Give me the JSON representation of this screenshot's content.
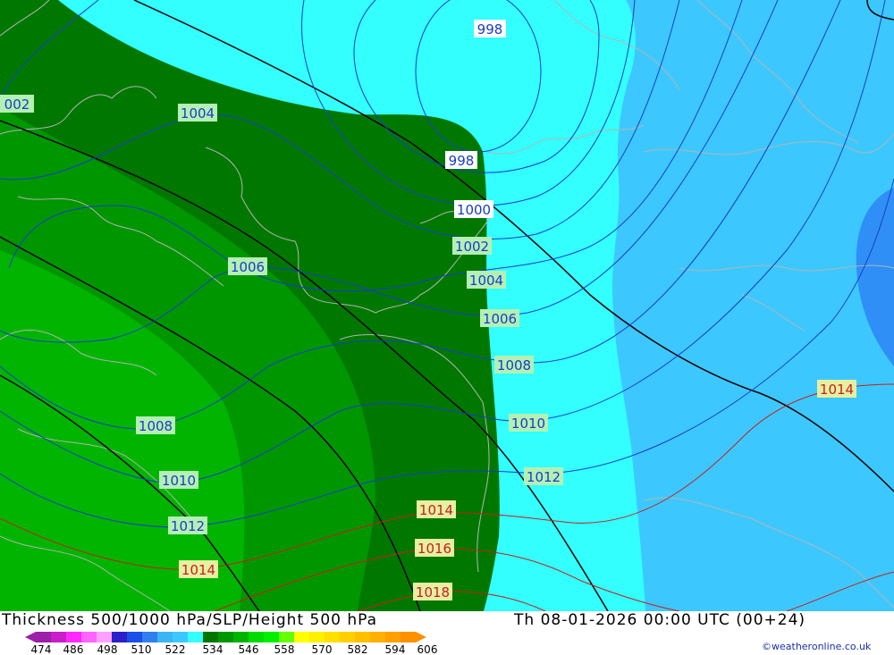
{
  "header": {
    "title": "Thickness 500/1000 hPa/SLP/Height 500 hPa",
    "valid_time": "Th 08-01-2026 00:00 UTC (00+24)",
    "credit": "©weatheronline.co.uk"
  },
  "colors": {
    "band_474": "#9b1fa8",
    "band_480": "#c81fc8",
    "band_486": "#ff28ff",
    "band_492": "#ff64ff",
    "band_498": "#ffa0ff",
    "band_504": "#2a1fc8",
    "band_510": "#1a4fe8",
    "band_516": "#2f7ff0",
    "band_522": "#3ab6f4",
    "band_528": "#3cc8ff",
    "band_534": "#33ffff",
    "band_540": "#007800",
    "band_546": "#009600",
    "band_552": "#00b400",
    "band_558": "#00dc00",
    "band_564": "#ffff00",
    "band_570": "#ffe000",
    "band_576": "#ffc000",
    "band_582": "#ffa000",
    "band_588": "#ff8000",
    "isobar": "#1a3cc8",
    "high_isobar": "#c81e1e",
    "height_line": "#000000",
    "coastline": "#b4b4b4"
  },
  "legend": {
    "ticks": [
      "474",
      "486",
      "498",
      "510",
      "522",
      "534",
      "546",
      "558",
      "570",
      "582",
      "594",
      "606"
    ]
  },
  "isobar_labels": [
    {
      "id": "998a",
      "text": "998"
    },
    {
      "id": "998b",
      "text": "998"
    },
    {
      "id": "1000",
      "text": "1000"
    },
    {
      "id": "1002a",
      "text": "1002"
    },
    {
      "id": "1002b",
      "text": "002"
    },
    {
      "id": "1004a",
      "text": "1004"
    },
    {
      "id": "1004b",
      "text": "1004"
    },
    {
      "id": "1006a",
      "text": "1006"
    },
    {
      "id": "1006b",
      "text": "1006"
    },
    {
      "id": "1008a",
      "text": "1008"
    },
    {
      "id": "1008b",
      "text": "1008"
    },
    {
      "id": "1010a",
      "text": "1010"
    },
    {
      "id": "1010b",
      "text": "1010"
    },
    {
      "id": "1012a",
      "text": "1012"
    },
    {
      "id": "1012b",
      "text": "1012"
    },
    {
      "id": "1014a",
      "text": "1014"
    },
    {
      "id": "1014b",
      "text": "1014"
    },
    {
      "id": "1014c",
      "text": "1014"
    },
    {
      "id": "1016",
      "text": "1016"
    },
    {
      "id": "1018",
      "text": "1018"
    }
  ]
}
